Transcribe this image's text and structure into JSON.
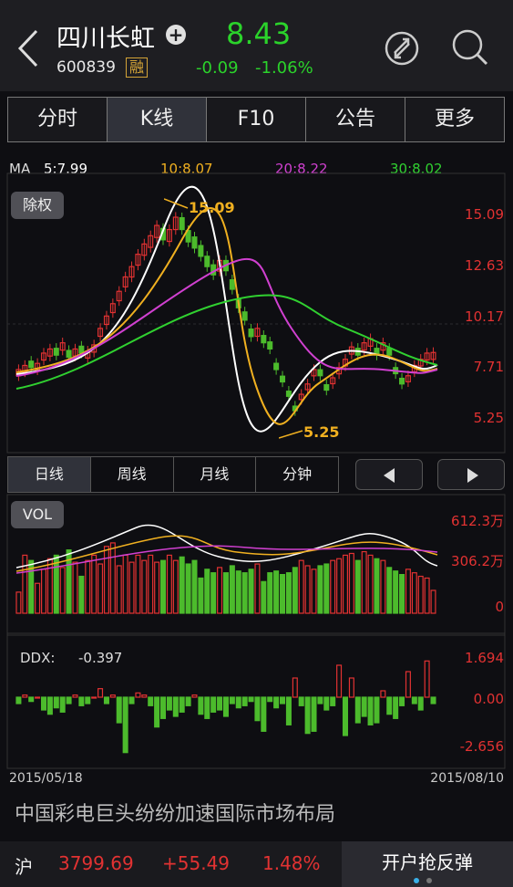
{
  "header": {
    "stock_name": "四川长虹",
    "code": "600839",
    "margin_badge": "融",
    "price": "8.43",
    "change": "-0.09",
    "change_pct": "-1.06%",
    "plus_label": "+"
  },
  "tabs": [
    {
      "label": "分时"
    },
    {
      "label": "K线",
      "active": true
    },
    {
      "label": "F10"
    },
    {
      "label": "公告"
    },
    {
      "label": "更多"
    }
  ],
  "ma_legend": {
    "ma": "MA",
    "ma5": "5:7.99",
    "ma10": "10:8.07",
    "ma20": "20:8.22",
    "ma30": "30:8.02"
  },
  "kchart": {
    "button": "除权",
    "price_labels": [
      "15.09",
      "12.63",
      "10.17",
      "7.71",
      "5.25"
    ],
    "high_label": "15.09",
    "low_label": "5.25"
  },
  "period_tabs": [
    {
      "label": "日线",
      "active": true
    },
    {
      "label": "周线"
    },
    {
      "label": "月线"
    },
    {
      "label": "分钟"
    }
  ],
  "vol": {
    "button": "VOL",
    "labels": [
      "612.3万",
      "306.2万",
      "0"
    ]
  },
  "ddx": {
    "label": "DDX:",
    "value": "-0.397",
    "labels": [
      "1.694",
      "0.00",
      "-2.656"
    ]
  },
  "dates": {
    "start": "2015/05/18",
    "end": "2015/08/10"
  },
  "news": "中国彩电巨头纷纷加速国际市场布局",
  "footer": {
    "index_name": "沪",
    "index_value": "3799.69",
    "index_change": "+55.49",
    "index_pct": "1.48%",
    "cta": "开户抢反弹"
  },
  "colors": {
    "up": "#e23232",
    "down": "#4cbb2c",
    "ma5": "#ffffff",
    "ma10": "#f0b020",
    "ma20": "#d040d0",
    "ma30": "#30d030"
  },
  "chart_data": [
    {
      "type": "candlestick",
      "title": "",
      "price_range": [
        5.25,
        15.09
      ],
      "high": 15.09,
      "low": 5.25,
      "closes": [
        7.6,
        7.8,
        7.7,
        7.9,
        8.4,
        8.6,
        8.3,
        8.9,
        8.2,
        8.6,
        8.4,
        8.5,
        8.8,
        9.6,
        10.2,
        10.8,
        11.4,
        12.1,
        12.6,
        13.2,
        13.7,
        14.1,
        14.6,
        13.9,
        14.4,
        15.0,
        14.4,
        13.8,
        13.5,
        13.1,
        12.6,
        12.2,
        12.9,
        12.4,
        11.5,
        10.6,
        10.0,
        9.2,
        9.6,
        8.9,
        8.6,
        7.6,
        7.0,
        6.3,
        5.6,
        6.4,
        6.9,
        7.6,
        7.3,
        6.6,
        7.2,
        7.7,
        8.1,
        8.7,
        8.3,
        8.9,
        9.1,
        8.3,
        8.9,
        8.3,
        7.4,
        6.9,
        7.3,
        7.8,
        8.1,
        8.4,
        8.43
      ],
      "up": [
        true,
        true,
        false,
        true,
        true,
        true,
        false,
        true,
        false,
        true,
        false,
        true,
        true,
        true,
        true,
        true,
        true,
        true,
        true,
        true,
        true,
        true,
        true,
        false,
        true,
        true,
        false,
        false,
        false,
        false,
        false,
        false,
        true,
        false,
        false,
        false,
        false,
        false,
        true,
        false,
        false,
        false,
        false,
        false,
        false,
        true,
        true,
        true,
        false,
        false,
        true,
        true,
        true,
        true,
        false,
        true,
        true,
        false,
        true,
        false,
        false,
        false,
        true,
        true,
        true,
        true,
        true
      ],
      "ma_lines": {
        "ma5": "8.00",
        "ma10": "8.07",
        "ma20": "8.22",
        "ma30": "8.02"
      }
    },
    {
      "type": "bar",
      "title": "VOL",
      "ylim": [
        0,
        612.3
      ],
      "unit": "万",
      "values": [
        120,
        330,
        300,
        170,
        250,
        310,
        330,
        260,
        360,
        290,
        210,
        300,
        330,
        280,
        380,
        400,
        270,
        330,
        290,
        330,
        300,
        330,
        290,
        300,
        330,
        300,
        320,
        280,
        300,
        200,
        250,
        230,
        260,
        230,
        270,
        240,
        230,
        250,
        280,
        180,
        230,
        240,
        220,
        230,
        260,
        300,
        270,
        250,
        270,
        280,
        300,
        310,
        330,
        340,
        300,
        350,
        330,
        310,
        300,
        260,
        240,
        220,
        250,
        230,
        210,
        200,
        130
      ]
    },
    {
      "type": "bar",
      "title": "DDX",
      "ylim": [
        -2.656,
        1.694
      ],
      "value": -0.397,
      "values": [
        -0.3,
        0.1,
        -0.2,
        0.0,
        -0.6,
        -0.8,
        -0.5,
        -0.7,
        -0.3,
        0.1,
        -0.4,
        -0.3,
        0.0,
        0.4,
        -0.3,
        0.1,
        -1.2,
        -2.6,
        -0.3,
        0.2,
        0.1,
        -0.4,
        -1.4,
        -1.0,
        -0.6,
        -0.9,
        -0.7,
        -0.4,
        0.1,
        -0.8,
        -1.0,
        -0.7,
        -0.6,
        -0.9,
        -0.3,
        -0.5,
        -0.4,
        -0.2,
        -1.1,
        -1.6,
        -0.2,
        -0.5,
        -0.3,
        -1.3,
        0.9,
        -0.4,
        -1.7,
        -1.6,
        -0.3,
        -0.6,
        -0.4,
        1.5,
        -1.8,
        0.9,
        -1.2,
        -0.9,
        -1.3,
        -1.2,
        0.3,
        -0.8,
        -1.0,
        -0.4,
        1.2,
        -0.3,
        -0.6,
        1.7,
        -0.3
      ]
    }
  ]
}
